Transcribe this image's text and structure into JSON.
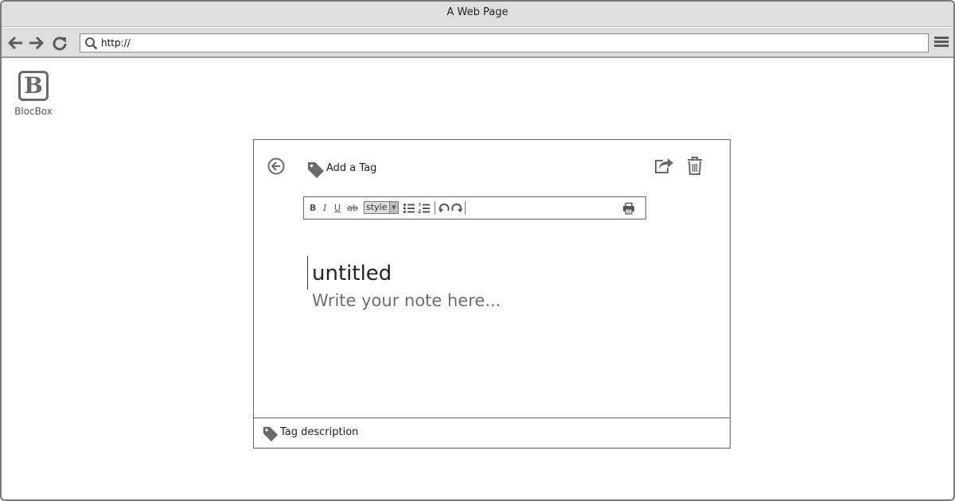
{
  "window": {
    "title": "A Web Page"
  },
  "browser": {
    "url_value": "http://",
    "icons": [
      "back-arrow",
      "forward-arrow",
      "reload",
      "search",
      "hamburger-menu"
    ]
  },
  "app": {
    "logo_letter": "B",
    "name": "BlocBox"
  },
  "note": {
    "add_tag_label": "Add a Tag",
    "title": "untitled",
    "body_placeholder": "Write your note here...",
    "footer_tag_label": "Tag description"
  },
  "toolbar": {
    "bold": "B",
    "italic": "I",
    "underline": "U",
    "strike": "ab",
    "style_select": "style",
    "style_dropdown_arrow": "▼"
  },
  "colors": {
    "chrome": "#dedede",
    "icon": "#6a6a6a",
    "border": "#666666"
  }
}
